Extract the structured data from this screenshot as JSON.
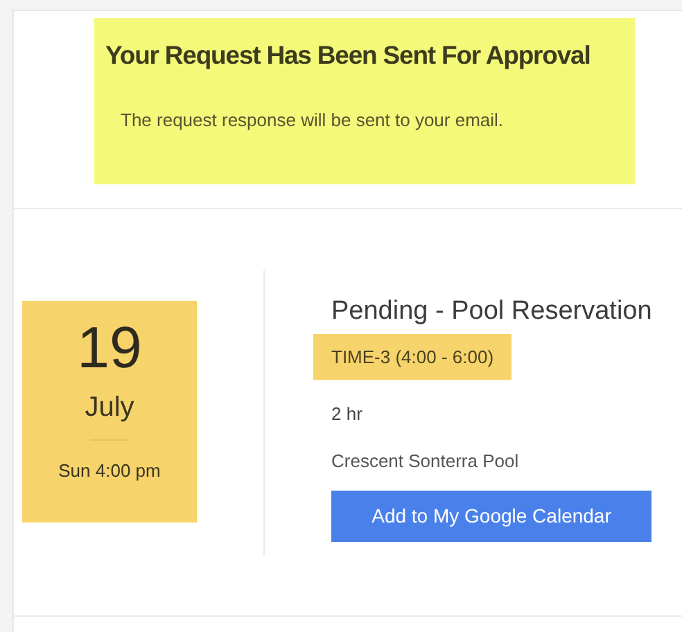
{
  "banner": {
    "title": "Your Request Has Been Sent For Approval",
    "message": "The request response will be sent to your email."
  },
  "reservation": {
    "day": "19",
    "month": "July",
    "weekday_time": "Sun 4:00 pm",
    "title": "Pending - Pool Reservation",
    "slot": "TIME-3 (4:00 - 6:00)",
    "duration": "2 hr",
    "location": "Crescent Sonterra Pool",
    "button": "Add to My Google Calendar"
  }
}
